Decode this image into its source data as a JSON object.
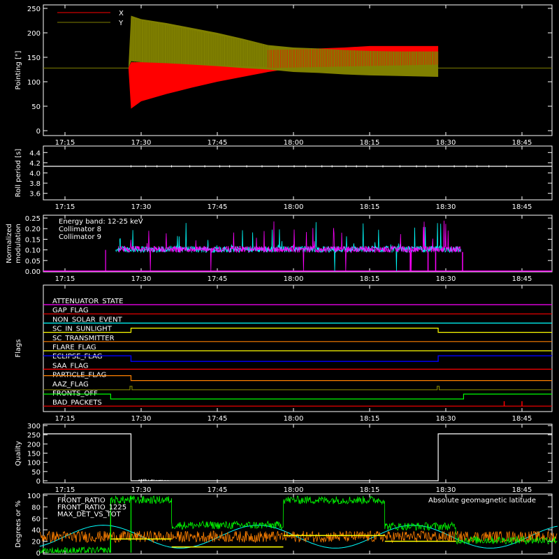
{
  "time_ticks": [
    "17:15",
    "17:30",
    "17:45",
    "18:00",
    "18:15",
    "18:30",
    "18:45"
  ],
  "time_range_minutes_after_1700": [
    10,
    60
  ],
  "panels": {
    "pointing": {
      "ylabel": "Pointing [\"]",
      "yticks": [
        "0",
        "50",
        "100",
        "150",
        "200",
        "250"
      ],
      "ylim": [
        0,
        250
      ],
      "legend": [
        {
          "name": "X",
          "color": "#ff0000"
        },
        {
          "name": "Y",
          "color": "#808000"
        }
      ]
    },
    "roll": {
      "ylabel": "Roll period [s]",
      "yticks": [
        "3.6",
        "3.8",
        "4.0",
        "4.2",
        "4.4"
      ],
      "ylim": [
        3.5,
        4.5
      ],
      "value": 4.13
    },
    "modulation": {
      "ylabel_line1": "Normalized",
      "ylabel_line2": "modulation",
      "yticks": [
        "0.00",
        "0.05",
        "0.10",
        "0.15",
        "0.20",
        "0.25"
      ],
      "ylim": [
        0,
        0.26
      ],
      "legend": [
        {
          "name": "Energy band: 12-25 keV",
          "color": "#ffffff"
        },
        {
          "name": "Collimator 8",
          "color": "#00ffff"
        },
        {
          "name": "Collimator 9",
          "color": "#ff00ff"
        }
      ]
    },
    "flags": {
      "ylabel": "Flags",
      "items": [
        {
          "name": "ATTENUATOR_STATE",
          "color": "#ff00ff"
        },
        {
          "name": "GAP_FLAG",
          "color": "#ff0000"
        },
        {
          "name": "NON_SOLAR_EVENT",
          "color": "#00ffff"
        },
        {
          "name": "SC_IN_SUNLIGHT",
          "color": "#ffff00"
        },
        {
          "name": "SC_TRANSMITTER",
          "color": "#ff8000"
        },
        {
          "name": "FLARE_FLAG",
          "color": "#ffff00"
        },
        {
          "name": "ECLIPSE_FLAG",
          "color": "#0000ff"
        },
        {
          "name": "SAA_FLAG",
          "color": "#ff0000"
        },
        {
          "name": "PARTICLE_FLAG",
          "color": "#ff8000"
        },
        {
          "name": "AAZ_FLAG",
          "color": "#808000"
        },
        {
          "name": "FRONTS_OFF",
          "color": "#00ff00"
        },
        {
          "name": "BAD_PACKETS",
          "color": "#ff0000"
        }
      ]
    },
    "quality": {
      "ylabel": "Quality",
      "yticks": [
        "0",
        "50",
        "100",
        "150",
        "200",
        "250",
        "300"
      ],
      "ylim": [
        0,
        300
      ]
    },
    "ratio": {
      "ylabel": "Degrees or %",
      "yticks": [
        "0",
        "20",
        "40",
        "60",
        "80",
        "100"
      ],
      "ylim": [
        0,
        100
      ],
      "legend": [
        {
          "name": "FRONT_RATIO",
          "color": "#ffff00"
        },
        {
          "name": "FRONT_RATIO_1225",
          "color": "#00ff00"
        },
        {
          "name": "MAX_DET_VS_TOT",
          "color": "#ff8000"
        }
      ],
      "annotation": {
        "text": "Absolute geomagnetic latitude",
        "color": "#00ffff"
      }
    }
  },
  "chart_data": [
    {
      "type": "line",
      "ylabel": "Pointing [\"]",
      "ylim": [
        0,
        250
      ],
      "baseline": 128,
      "series": [
        {
          "name": "X",
          "x": [
            27.5,
            28,
            30,
            35,
            40,
            45,
            50,
            55,
            60,
            65,
            70,
            75,
            80,
            88.5
          ],
          "y_upper": [
            128,
            140,
            140,
            145,
            148,
            150,
            155,
            160,
            165,
            168,
            170,
            173,
            173,
            173
          ],
          "y_lower": [
            128,
            45,
            60,
            75,
            88,
            100,
            110,
            120,
            128,
            130,
            132,
            135,
            135,
            135
          ]
        },
        {
          "name": "Y",
          "x": [
            27.5,
            28,
            30,
            35,
            40,
            45,
            50,
            55,
            60,
            65,
            70,
            75,
            80,
            88.5
          ],
          "y_upper": [
            128,
            235,
            228,
            220,
            210,
            200,
            188,
            175,
            170,
            168,
            165,
            163,
            162,
            162
          ],
          "y_lower": [
            128,
            142,
            140,
            138,
            135,
            132,
            128,
            125,
            120,
            118,
            115,
            113,
            112,
            110
          ]
        }
      ]
    },
    {
      "type": "line",
      "ylabel": "Roll period [s]",
      "ylim": [
        3.5,
        4.5
      ],
      "series": [
        {
          "x": [
            10,
            60
          ],
          "y": [
            4.13,
            4.13
          ]
        }
      ]
    },
    {
      "type": "line",
      "ylabel": "Normalized modulation",
      "ylim": [
        0,
        0.26
      ],
      "series": [
        {
          "name": "Collimator 8",
          "x_start": 25,
          "x_end": 93,
          "typical": 0.1
        },
        {
          "name": "Collimator 9",
          "x_start": 23,
          "x_end": 93.3,
          "typical": 0.1
        }
      ]
    },
    {
      "type": "line",
      "ylabel": "Flags",
      "series": [
        {
          "name": "ATTENUATOR_STATE",
          "segments": [
            [
              10,
              0
            ],
            [
              60,
              0
            ]
          ]
        },
        {
          "name": "SC_IN_SUNLIGHT",
          "segments": [
            [
              10,
              0
            ],
            [
              28,
              0
            ],
            [
              28,
              1
            ],
            [
              88.5,
              1
            ],
            [
              88.5,
              0
            ],
            [
              60,
              0
            ]
          ]
        },
        {
          "name": "ECLIPSE_FLAG",
          "segments": [
            [
              10,
              1
            ],
            [
              28,
              1
            ],
            [
              28,
              0
            ],
            [
              88.5,
              0
            ],
            [
              88.5,
              1
            ],
            [
              60,
              1
            ]
          ]
        },
        {
          "name": "FRONTS_OFF",
          "segments": [
            [
              10,
              1
            ],
            [
              24,
              1
            ],
            [
              24,
              0
            ],
            [
              93.5,
              0
            ],
            [
              93.5,
              1
            ],
            [
              60,
              1
            ]
          ]
        }
      ]
    },
    {
      "type": "line",
      "ylabel": "Quality",
      "ylim": [
        0,
        300
      ],
      "series": [
        {
          "x": [
            10,
            28,
            28,
            88.5,
            88.5,
            60
          ],
          "y": [
            255,
            255,
            0,
            0,
            255,
            255
          ]
        }
      ]
    },
    {
      "type": "line",
      "ylabel": "Degrees or %",
      "ylim": [
        0,
        100
      ],
      "series": [
        {
          "name": "FRONT_RATIO_1225",
          "x": [
            10,
            24,
            24,
            36,
            36,
            58,
            58,
            78,
            78,
            92,
            92,
            60
          ],
          "y": [
            5,
            5,
            95,
            95,
            50,
            50,
            93,
            93,
            48,
            48,
            20,
            20
          ]
        },
        {
          "name": "MAX_DET_VS_TOT",
          "typical": 30
        },
        {
          "name": "FRONT_RATIO",
          "x": [
            10,
            24,
            24,
            36,
            36,
            58,
            58,
            78,
            78,
            92,
            92,
            60
          ],
          "y": [
            28,
            28,
            20,
            20,
            10,
            10,
            30,
            30,
            20,
            20,
            28,
            28
          ]
        },
        {
          "name": "Absolute geomagnetic latitude",
          "x": [
            10,
            18,
            24,
            32,
            40,
            50,
            58,
            66,
            74,
            84,
            92,
            60
          ],
          "y": [
            30,
            48,
            30,
            48,
            12,
            20,
            48,
            30,
            48,
            12,
            20,
            35
          ]
        }
      ]
    }
  ]
}
